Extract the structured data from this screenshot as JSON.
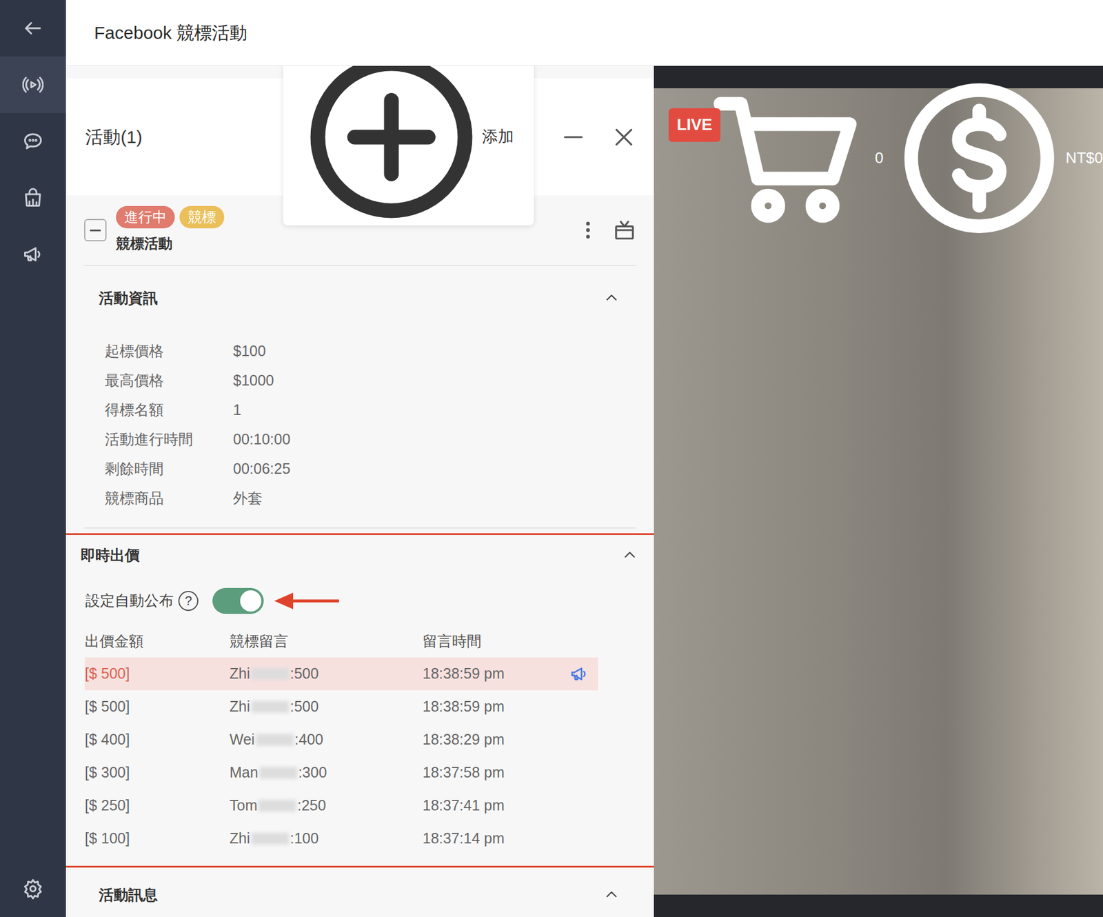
{
  "header": {
    "title": "Facebook 競標活動"
  },
  "sidebar": {
    "items": [
      {
        "kind": "back",
        "selected": false
      },
      {
        "kind": "live",
        "selected": true
      },
      {
        "kind": "chat",
        "selected": false
      },
      {
        "kind": "shop",
        "selected": false
      },
      {
        "kind": "promo",
        "selected": false
      },
      {
        "kind": "settings",
        "selected": false
      }
    ]
  },
  "video": {
    "cart_count": "0",
    "amount": "NT$0",
    "live": "LIVE"
  },
  "panel": {
    "title": "活動(1)",
    "add_button": "添加"
  },
  "activity": {
    "expanded": true,
    "tags": [
      {
        "label": "進行中",
        "color": "#e07b6e"
      },
      {
        "label": "競標",
        "color": "#ebbf5a"
      }
    ],
    "title": "競標活動"
  },
  "info": {
    "title": "活動資訊",
    "expanded": true,
    "rows": [
      [
        "起標價格",
        "$100"
      ],
      [
        "最高價格",
        "$1000"
      ],
      [
        "得標名額",
        "1"
      ],
      [
        "活動進行時間",
        "00:10:00"
      ],
      [
        "剩餘時間",
        "00:06:25"
      ],
      [
        "競標商品",
        "外套"
      ]
    ]
  },
  "bids": {
    "title": "即時出價",
    "expanded": true,
    "auto_publish": {
      "label": "設定自動公布",
      "help": "?",
      "on": true
    },
    "columns": [
      "出價金額",
      "競標留言",
      "留言時間"
    ],
    "rows": [
      {
        "amount": "[$ 500]",
        "name": "Zhi",
        "text": ":500",
        "time": "18:38:59 pm",
        "selected": true
      },
      {
        "amount": "[$ 500]",
        "name": "Zhi",
        "text": ":500",
        "time": "18:38:59 pm",
        "selected": false
      },
      {
        "amount": "[$ 400]",
        "name": "Wei",
        "text": ":400",
        "time": "18:38:29 pm",
        "selected": false
      },
      {
        "amount": "[$ 300]",
        "name": "Man",
        "text": ":300",
        "time": "18:37:58 pm",
        "selected": false
      },
      {
        "amount": "[$ 250]",
        "name": "Tom",
        "text": ":250",
        "time": "18:37:41 pm",
        "selected": false
      },
      {
        "amount": "[$ 100]",
        "name": "Zhi",
        "text": ":100",
        "time": "18:37:14 pm",
        "selected": false
      }
    ]
  },
  "messages": {
    "title": "活動訊息",
    "expanded": true
  }
}
